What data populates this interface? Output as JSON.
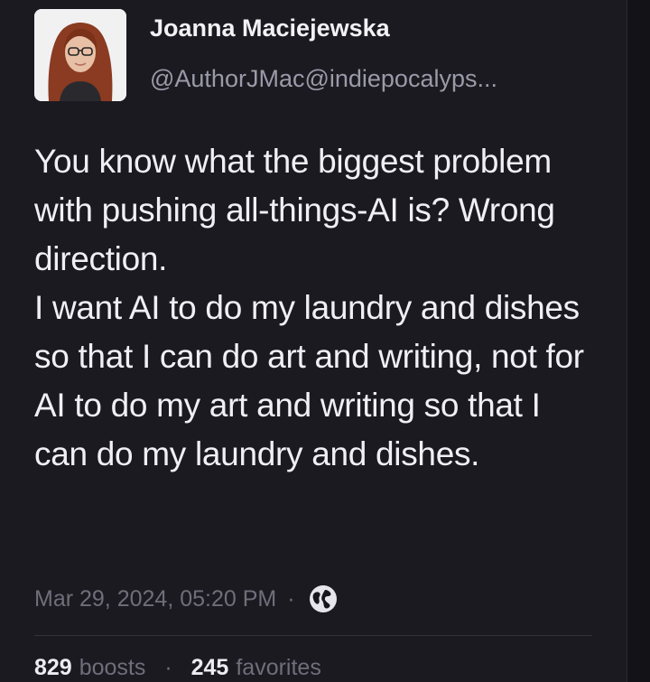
{
  "post": {
    "author": {
      "display_name": "Joanna Maciejewska",
      "handle": "@AuthorJMac@indiepocalyps..."
    },
    "body": "You know what the biggest problem with pushing all-things-AI is? Wrong direction.\nI want AI to do my laundry and dishes so that I can do art and writing, not for AI to do my art and writing so that I can do my laundry and dishes.",
    "timestamp": "Mar 29, 2024, 05:20 PM",
    "separator": "·",
    "visibility_icon": "globe-icon",
    "stats": {
      "boosts_count": "829",
      "boosts_label": "boosts",
      "favorites_count": "245",
      "favorites_label": "favorites"
    }
  },
  "colors": {
    "background": "#1b1a21",
    "text": "#f0f0f4",
    "muted": "#6f6e7a",
    "handle": "#9b9aa8"
  }
}
